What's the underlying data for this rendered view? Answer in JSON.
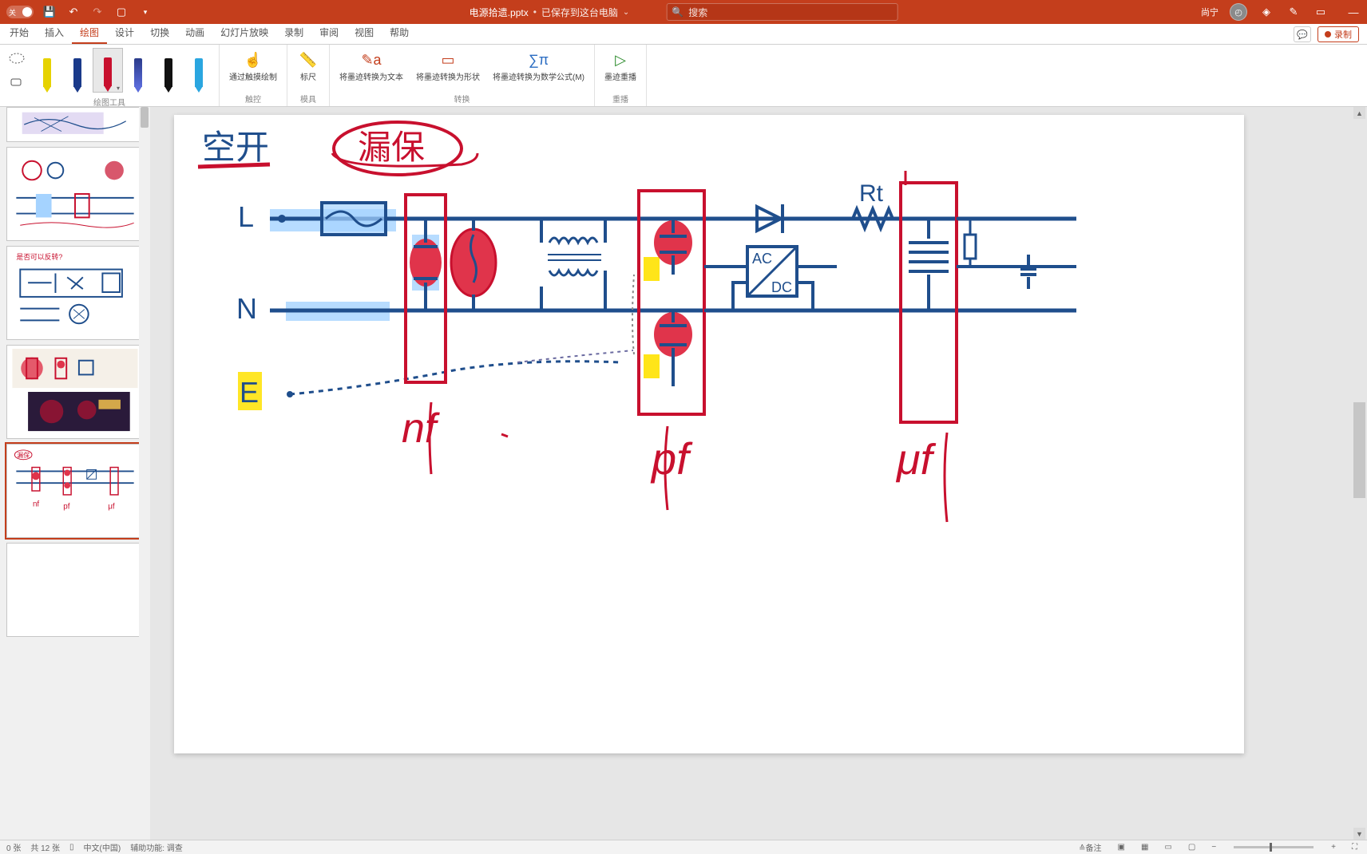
{
  "title_bar": {
    "autosave_label": "关",
    "filename": "电源拾遗.pptx",
    "saved_status": "已保存到这台电脑",
    "search_placeholder": "搜索",
    "user_name": "尚宁"
  },
  "tabs": {
    "items": [
      "开始",
      "插入",
      "绘图",
      "设计",
      "切换",
      "动画",
      "幻灯片放映",
      "录制",
      "审阅",
      "视图",
      "帮助"
    ],
    "active_index": 2,
    "comments_label": "",
    "record_label": "录制"
  },
  "ribbon": {
    "groups": {
      "draw_tools": "绘图工具",
      "touch": "触控",
      "stencil": "模具",
      "convert": "转换",
      "replay": "重播"
    },
    "buttons": {
      "touch_draw": "通过触摸绘制",
      "ruler": "标尺",
      "ink_to_text": "将墨迹转换为文本",
      "ink_to_shape": "将墨迹转换为形状",
      "ink_to_math": "将墨迹转换为数学公式(M)",
      "ink_replay": "墨迹重播"
    },
    "pens": [
      {
        "name": "yellow-highlighter",
        "body": "#e6d200",
        "tip": "#e6d200"
      },
      {
        "name": "blue-pen",
        "body": "#1a3a8a",
        "tip": "#1a3a8a"
      },
      {
        "name": "red-pen",
        "body": "#c8102e",
        "tip": "#c8102e",
        "active": true
      },
      {
        "name": "bluegrad-pen",
        "body": "#2a3b8a",
        "tip": "#5a6bda"
      },
      {
        "name": "black-zig-pen",
        "body": "#111",
        "tip": "#111"
      },
      {
        "name": "cyan-highlighter",
        "body": "#2aa6e0",
        "tip": "#2aa6e0"
      }
    ]
  },
  "status_bar": {
    "slide": "0 张",
    "total": "共 12 张",
    "lang": "中文(中国)",
    "access": "辅助功能: 调查",
    "notes": "备注",
    "zoom_minus": "−",
    "zoom_plus": "+"
  },
  "slide_content": {
    "labels": {
      "kongkai": "空开",
      "loubao": "漏保",
      "L": "L",
      "N": "N",
      "E": "E",
      "nf": "nf",
      "pf": "pf",
      "uf": "μf",
      "Rt": "Rt",
      "acdc_top": "AC",
      "acdc_bot": "DC"
    }
  },
  "colors": {
    "brand": "#c43e1c",
    "ink_blue": "#1f4e8c",
    "ink_red": "#c8102e",
    "hl_yellow": "#ffe200",
    "hl_blue": "#a5d3ff",
    "red_fill": "#e0344b"
  }
}
